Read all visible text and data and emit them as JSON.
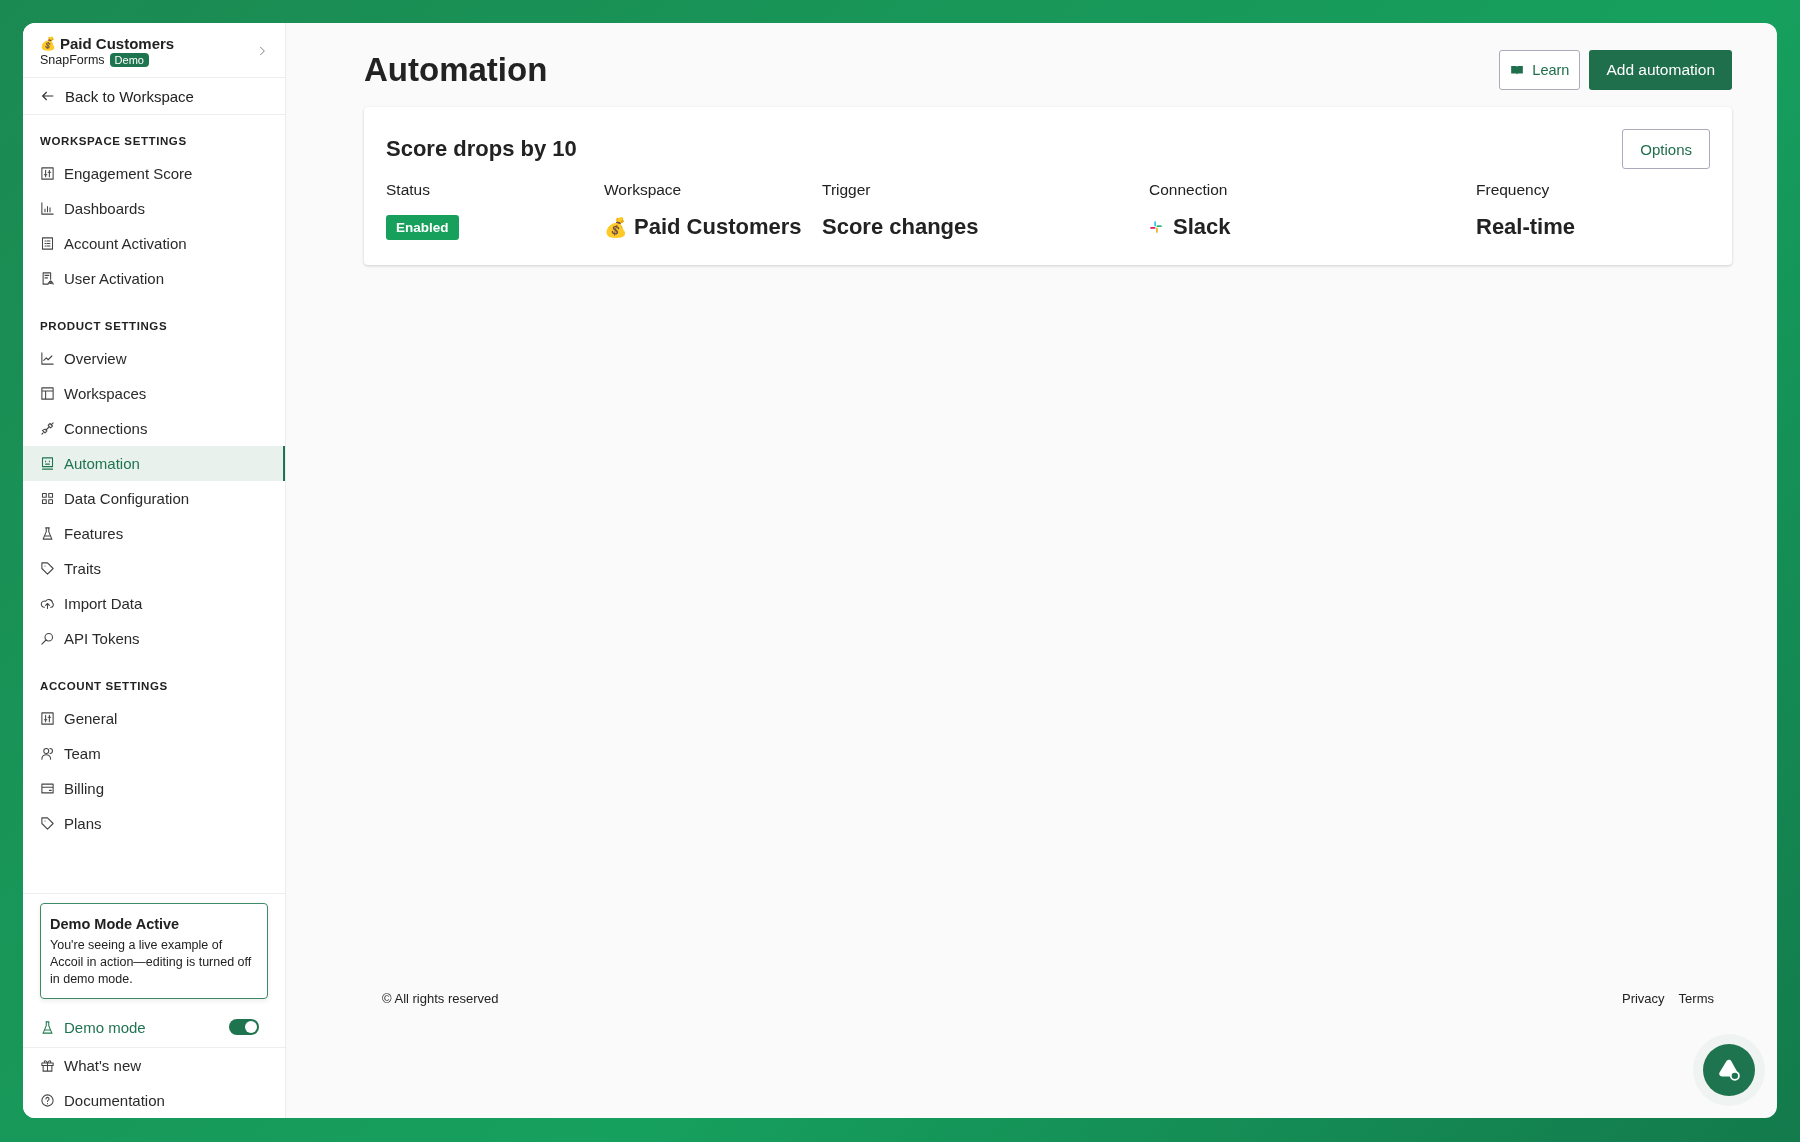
{
  "workspace_switcher": {
    "emoji": "💰",
    "name": "Paid Customers",
    "org": "SnapForms",
    "badge": "Demo"
  },
  "back_link": {
    "label": "Back to Workspace"
  },
  "sidebar": {
    "sections": [
      {
        "title": "WORKSPACE SETTINGS",
        "items": [
          {
            "label": "Engagement Score",
            "selected": false
          },
          {
            "label": "Dashboards",
            "selected": false
          },
          {
            "label": "Account Activation",
            "selected": false
          },
          {
            "label": "User Activation",
            "selected": false
          }
        ]
      },
      {
        "title": "PRODUCT SETTINGS",
        "items": [
          {
            "label": "Overview",
            "selected": false
          },
          {
            "label": "Workspaces",
            "selected": false
          },
          {
            "label": "Connections",
            "selected": false
          },
          {
            "label": "Automation",
            "selected": true
          },
          {
            "label": "Data Configuration",
            "selected": false
          },
          {
            "label": "Features",
            "selected": false
          },
          {
            "label": "Traits",
            "selected": false
          },
          {
            "label": "Import Data",
            "selected": false
          },
          {
            "label": "API Tokens",
            "selected": false
          }
        ]
      },
      {
        "title": "ACCOUNT SETTINGS",
        "items": [
          {
            "label": "General",
            "selected": false
          },
          {
            "label": "Team",
            "selected": false
          },
          {
            "label": "Billing",
            "selected": false
          },
          {
            "label": "Plans",
            "selected": false
          }
        ]
      }
    ]
  },
  "demo_notice": {
    "title": "Demo Mode Active",
    "text": "You're seeing a live example of Accoil in action—editing is turned off in demo mode."
  },
  "demo_mode": {
    "label": "Demo mode",
    "on": true
  },
  "bottom_links": [
    "What's new",
    "Documentation"
  ],
  "page": {
    "title": "Automation",
    "buttons": {
      "learn": "Learn",
      "add": "Add automation"
    }
  },
  "automations": [
    {
      "name": "Score drops by 10",
      "options": "Options",
      "fields": [
        {
          "label": "Status",
          "kind": "badge",
          "value": "Enabled"
        },
        {
          "label": "Workspace",
          "kind": "workspace",
          "emoji": "💰",
          "value": "Paid Customers"
        },
        {
          "label": "Trigger",
          "kind": "text",
          "value": "Score changes"
        },
        {
          "label": "Connection",
          "kind": "slack",
          "value": "Slack"
        },
        {
          "label": "Frequency",
          "kind": "text",
          "value": "Real-time"
        }
      ]
    }
  ],
  "footer": {
    "copyright": "© All rights reserved",
    "links": [
      "Privacy",
      "Terms"
    ]
  }
}
